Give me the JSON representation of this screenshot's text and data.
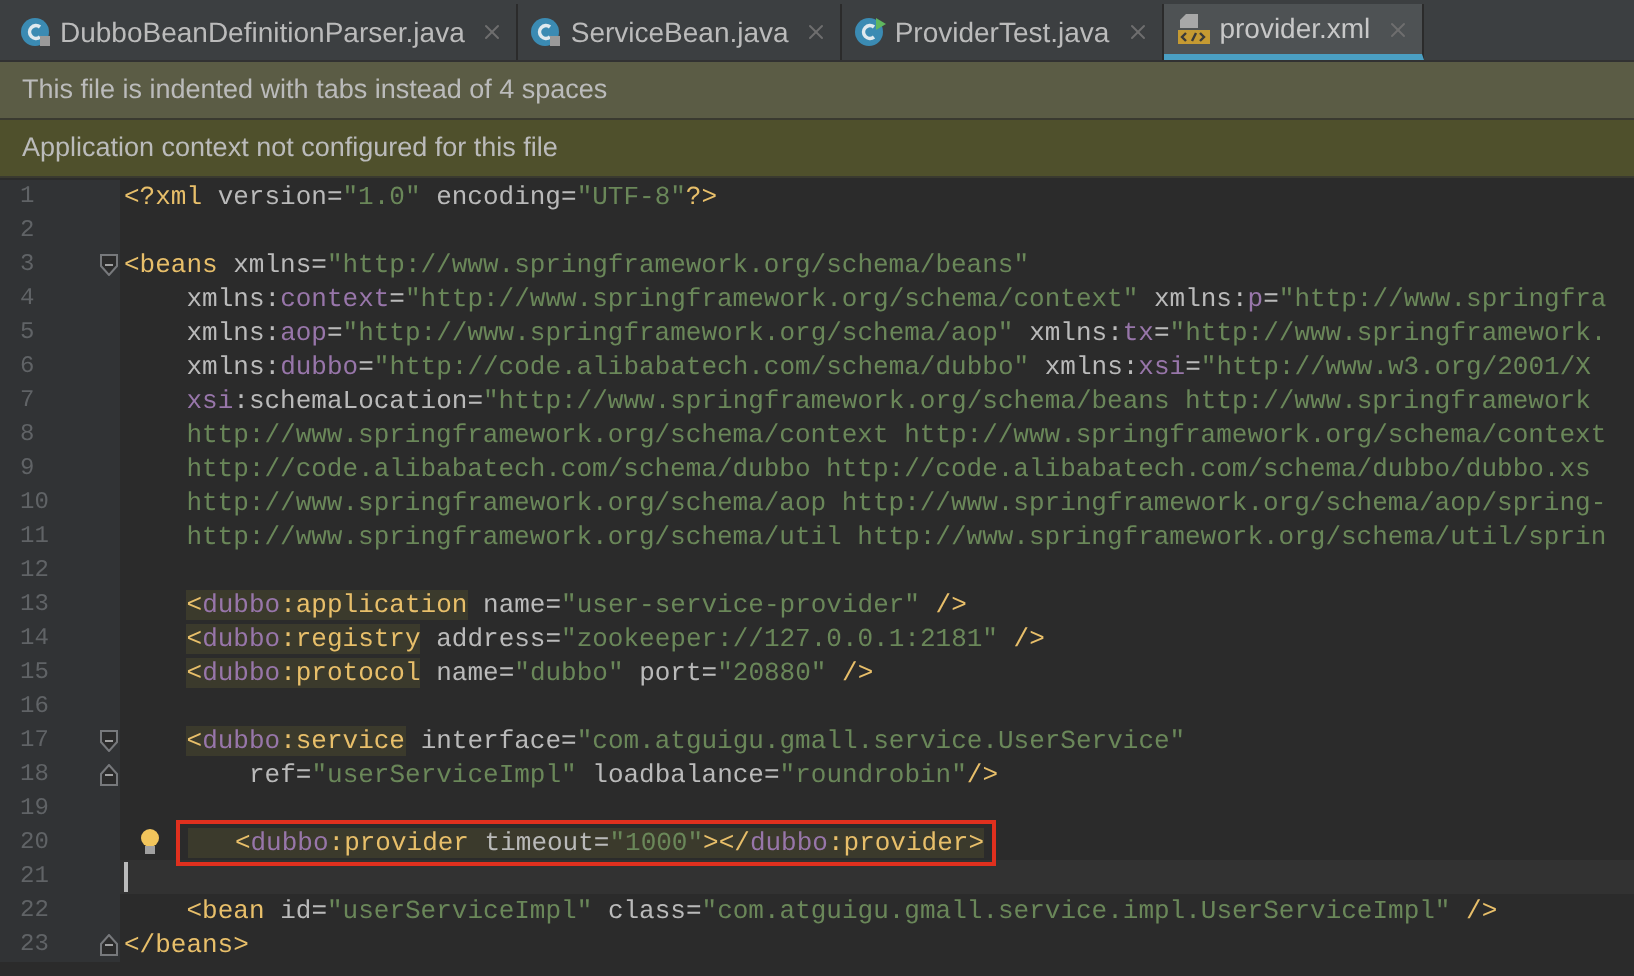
{
  "tabs": [
    {
      "label": "DubboBeanDefinitionParser.java",
      "kind": "class",
      "selected": false
    },
    {
      "label": "ServiceBean.java",
      "kind": "class",
      "selected": false
    },
    {
      "label": "ProviderTest.java",
      "kind": "test",
      "selected": false
    },
    {
      "label": "provider.xml",
      "kind": "xml",
      "selected": true
    }
  ],
  "notices": [
    {
      "text": "This file is indented with tabs instead of 4 spaces",
      "kind": "info"
    },
    {
      "text": "Application context not configured for this file",
      "kind": "warning"
    }
  ],
  "editor": {
    "lines": [
      {
        "number": "1",
        "kind": "code",
        "text": "<?xml version=\"1.0\" encoding=\"UTF-8\"?>"
      },
      {
        "number": "2",
        "kind": "blank"
      },
      {
        "number": "3",
        "kind": "code",
        "text": "<beans xmlns=\"http://www.springframework.org/schema/beans\"",
        "fold_start": true
      },
      {
        "number": "4",
        "kind": "code",
        "text": "    xmlns:context=\"http://www.springframework.org/schema/context\" xmlns:p=\"http://www.springfra"
      },
      {
        "number": "5",
        "kind": "code",
        "text": "    xmlns:aop=\"http://www.springframework.org/schema/aop\" xmlns:tx=\"http://www.springframework."
      },
      {
        "number": "6",
        "kind": "code",
        "text": "    xmlns:dubbo=\"http://code.alibabatech.com/schema/dubbo\" xmlns:xsi=\"http://www.w3.org/2001/X"
      },
      {
        "number": "7",
        "kind": "code",
        "text": "    xsi:schemaLocation=\"http://www.springframework.org/schema/beans http://www.springframework"
      },
      {
        "number": "8",
        "kind": "code",
        "text": "    http://www.springframework.org/schema/context http://www.springframework.org/schema/context"
      },
      {
        "number": "9",
        "kind": "code",
        "text": "    http://code.alibabatech.com/schema/dubbo http://code.alibabatech.com/schema/dubbo/dubbo.xs"
      },
      {
        "number": "10",
        "kind": "code",
        "text": "    http://www.springframework.org/schema/aop http://www.springframework.org/schema/aop/spring-"
      },
      {
        "number": "11",
        "kind": "code",
        "text": "    http://www.springframework.org/schema/util http://www.springframework.org/schema/util/sprin"
      },
      {
        "number": "12",
        "kind": "blank"
      },
      {
        "number": "13",
        "kind": "code",
        "text": "    <dubbo:application name=\"user-service-provider\" />"
      },
      {
        "number": "14",
        "kind": "code",
        "text": "    <dubbo:registry address=\"zookeeper://127.0.0.1:2181\" />"
      },
      {
        "number": "15",
        "kind": "code",
        "text": "    <dubbo:protocol name=\"dubbo\" port=\"20880\" />"
      },
      {
        "number": "16",
        "kind": "blank"
      },
      {
        "number": "17",
        "kind": "code",
        "text": "    <dubbo:service interface=\"com.atguigu.gmall.service.UserService\"",
        "fold_start": true
      },
      {
        "number": "18",
        "kind": "code",
        "text": "        ref=\"userServiceImpl\" loadbalance=\"roundrobin\"/>",
        "fold_end": true
      },
      {
        "number": "19",
        "kind": "blank"
      },
      {
        "number": "20",
        "kind": "code",
        "text": "    <dubbo:provider timeout=\"1000\"></dubbo:provider>",
        "bulb": true,
        "boxed": true
      },
      {
        "number": "21",
        "kind": "caret"
      },
      {
        "number": "22",
        "kind": "code",
        "text": "    <bean id=\"userServiceImpl\" class=\"com.atguigu.gmall.service.impl.UserServiceImpl\" />"
      },
      {
        "number": "23",
        "kind": "code",
        "text": "</beans>",
        "fold_end": true
      }
    ]
  }
}
